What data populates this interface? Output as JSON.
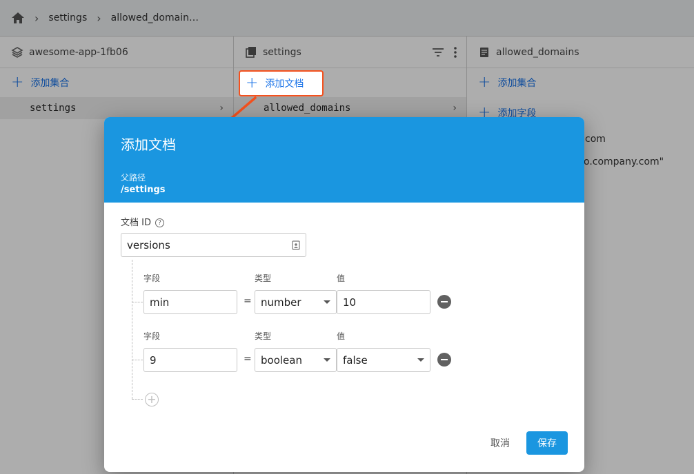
{
  "breadcrumb": {
    "items": [
      "settings",
      "allowed_domain…"
    ]
  },
  "columns": {
    "col1": {
      "title": "awesome-app-1fb06",
      "add_label": "添加集合",
      "items": [
        "settings"
      ]
    },
    "col2": {
      "title": "settings",
      "add_label": "添加文档",
      "items": [
        "allowed_domains"
      ]
    },
    "col3": {
      "title": "allowed_domains",
      "add_label": "添加集合",
      "add_field_label": "添加字段",
      "peek_lines": [
        "com",
        "o.company.com\""
      ]
    }
  },
  "dialog": {
    "title": "添加文档",
    "parent_path_label": "父路径",
    "parent_path": "/settings",
    "doc_id_label": "文档 ID",
    "doc_id_value": "versions",
    "fields": [
      {
        "field_label": "字段",
        "type_label": "类型",
        "value_label": "值",
        "field": "min",
        "type": "number",
        "value": "10",
        "value_is_select": false
      },
      {
        "field_label": "字段",
        "type_label": "类型",
        "value_label": "值",
        "field": "9",
        "type": "boolean",
        "value": "false",
        "value_is_select": true
      }
    ],
    "eq": "=",
    "cancel_label": "取消",
    "save_label": "保存"
  },
  "colors": {
    "accent": "#1a96e0",
    "highlight": "#f4511e"
  }
}
